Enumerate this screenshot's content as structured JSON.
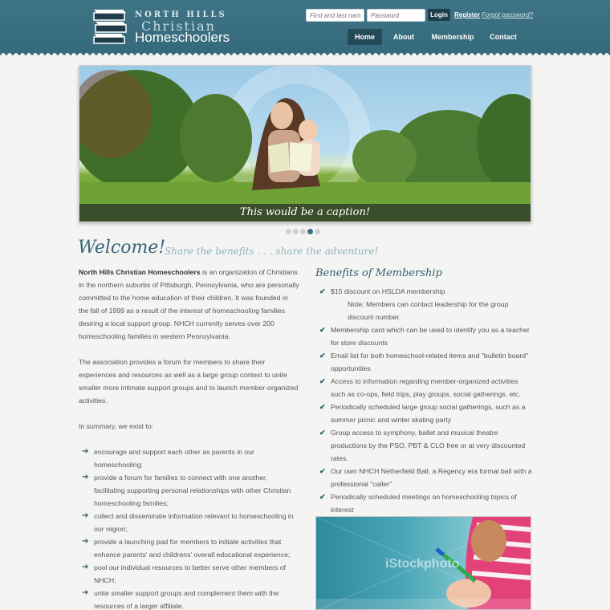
{
  "header": {
    "logo_line1": "NORTH HILLS",
    "logo_line2": "Christian",
    "logo_line3": "Homeschoolers",
    "login": {
      "name_placeholder": "First and last name",
      "password_placeholder": "Password",
      "login_label": "Login",
      "register_label": "Register",
      "forgot_label": "Forgot password?"
    },
    "nav": [
      {
        "label": "Home"
      },
      {
        "label": "About"
      },
      {
        "label": "Membership"
      },
      {
        "label": "Contact"
      }
    ]
  },
  "hero": {
    "caption": "This would be a caption!",
    "active_slide": 4,
    "slide_count": 5
  },
  "welcome": {
    "heading": "Welcome!",
    "tagline": "Share the benefits . . . share the adventure!"
  },
  "intro": {
    "org_name": "North Hills Christian Homeschoolers",
    "p1_rest": " is an organization of Christians in the northern suburbs of Pittsburgh, Pennsylvania, who are personally committed to the home education of their children. It was founded in the fall of 1999 as a result of the interest of homeschooling families desiring a local support group. NHCH currently serves over 200 homeschooling families in western Pennsylvania.",
    "p2": "The association provides a forum for members to share their experiences and resources as well as a large group context to unite smaller more intimate support groups and to launch member-organized activities.",
    "p3": "In summary, we exist to:",
    "purposes": [
      "encourage and support each other as parents in our homeschooling;",
      "provide a forum for families to connect with one another, facilitating supporting personal relationships with other Christian homeschooling families;",
      "collect and disseminate information relevant to homeschooling in our region;",
      "provide a launching pad for members to initiate activities that enhance parents' and childrens' overall educational experience;",
      "pool our individual resources to better serve other members of NHCH;",
      "unite smaller support groups and complement them with the resources of a larger affiliate."
    ]
  },
  "benefits": {
    "title": "Benefits of Membership",
    "items": [
      {
        "text": "$15 discount on HSLDA membership",
        "note": "Note: Members can contact leadership for the group discount number."
      },
      {
        "text": "Membership card which can be used to identify you as a teacher for store discounts"
      },
      {
        "text": "Email list for both homeschool-related items and \"bulletin board\" opportunities"
      },
      {
        "text": "Access to information regarding member-organized activities such as co-ops, field trips, play groups, social gatherings, etc."
      },
      {
        "text": "Periodically scheduled large group social gatherings, such as a summer picnic and winter skating party"
      },
      {
        "text": "Group access to symphony, ballet and musical theatre productions by the PSO, PBT & CLO free or at very discounted rates."
      },
      {
        "text": "Our own NHCH Netherfield Ball, a Regency era formal ball with a professional \"caller\""
      },
      {
        "text": "Periodically scheduled meetings on homeschooling topics of interest"
      }
    ]
  },
  "photo2": {
    "watermark": "iStockphoto"
  },
  "colors": {
    "header": "#3f7486",
    "accent": "#35667a",
    "nav_active": "#244a57"
  }
}
